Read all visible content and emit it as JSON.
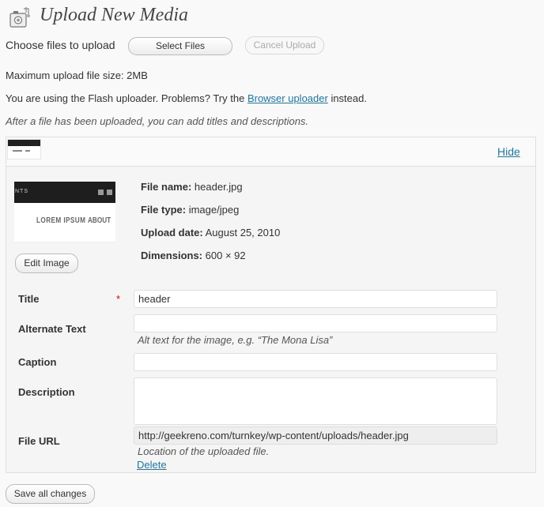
{
  "header": {
    "icon": "media-upload-icon",
    "title": "Upload New Media"
  },
  "uploader": {
    "choose_label": "Choose files to upload",
    "select_button": "Select Files",
    "cancel_button": "Cancel Upload",
    "max_size_text": "Maximum upload file size: 2MB",
    "flash_text_before": "You are using the Flash uploader. Problems? Try the ",
    "flash_link": "Browser uploader",
    "flash_text_after": " instead.",
    "after_note": "After a file has been uploaded, you can add titles and descriptions."
  },
  "item": {
    "hide_link": "Hide",
    "thumbnail": {
      "bar_text": "NTS",
      "nav1": "LOREM IPSUM",
      "nav2": "ABOUT"
    },
    "edit_button": "Edit Image",
    "meta": {
      "file_name_label": "File name:",
      "file_name": "header.jpg",
      "file_type_label": "File type:",
      "file_type": "image/jpeg",
      "upload_date_label": "Upload date:",
      "upload_date": "August 25, 2010",
      "dimensions_label": "Dimensions:",
      "dimensions": "600 × 92"
    },
    "fields": {
      "title_label": "Title",
      "required_mark": "*",
      "title_value": "header",
      "alt_label": "Alternate Text",
      "alt_value": "",
      "alt_help": "Alt text for the image, e.g. “The Mona Lisa”",
      "caption_label": "Caption",
      "caption_value": "",
      "description_label": "Description",
      "description_value": "",
      "url_label": "File URL",
      "url_value": "http://geekreno.com/turnkey/wp-content/uploads/header.jpg",
      "url_help": "Location of the uploaded file."
    },
    "delete_link": "Delete"
  },
  "footer": {
    "save_button": "Save all changes"
  },
  "colors": {
    "link": "#21759b",
    "required": "#dd0000",
    "background": "#f9f9f9"
  }
}
